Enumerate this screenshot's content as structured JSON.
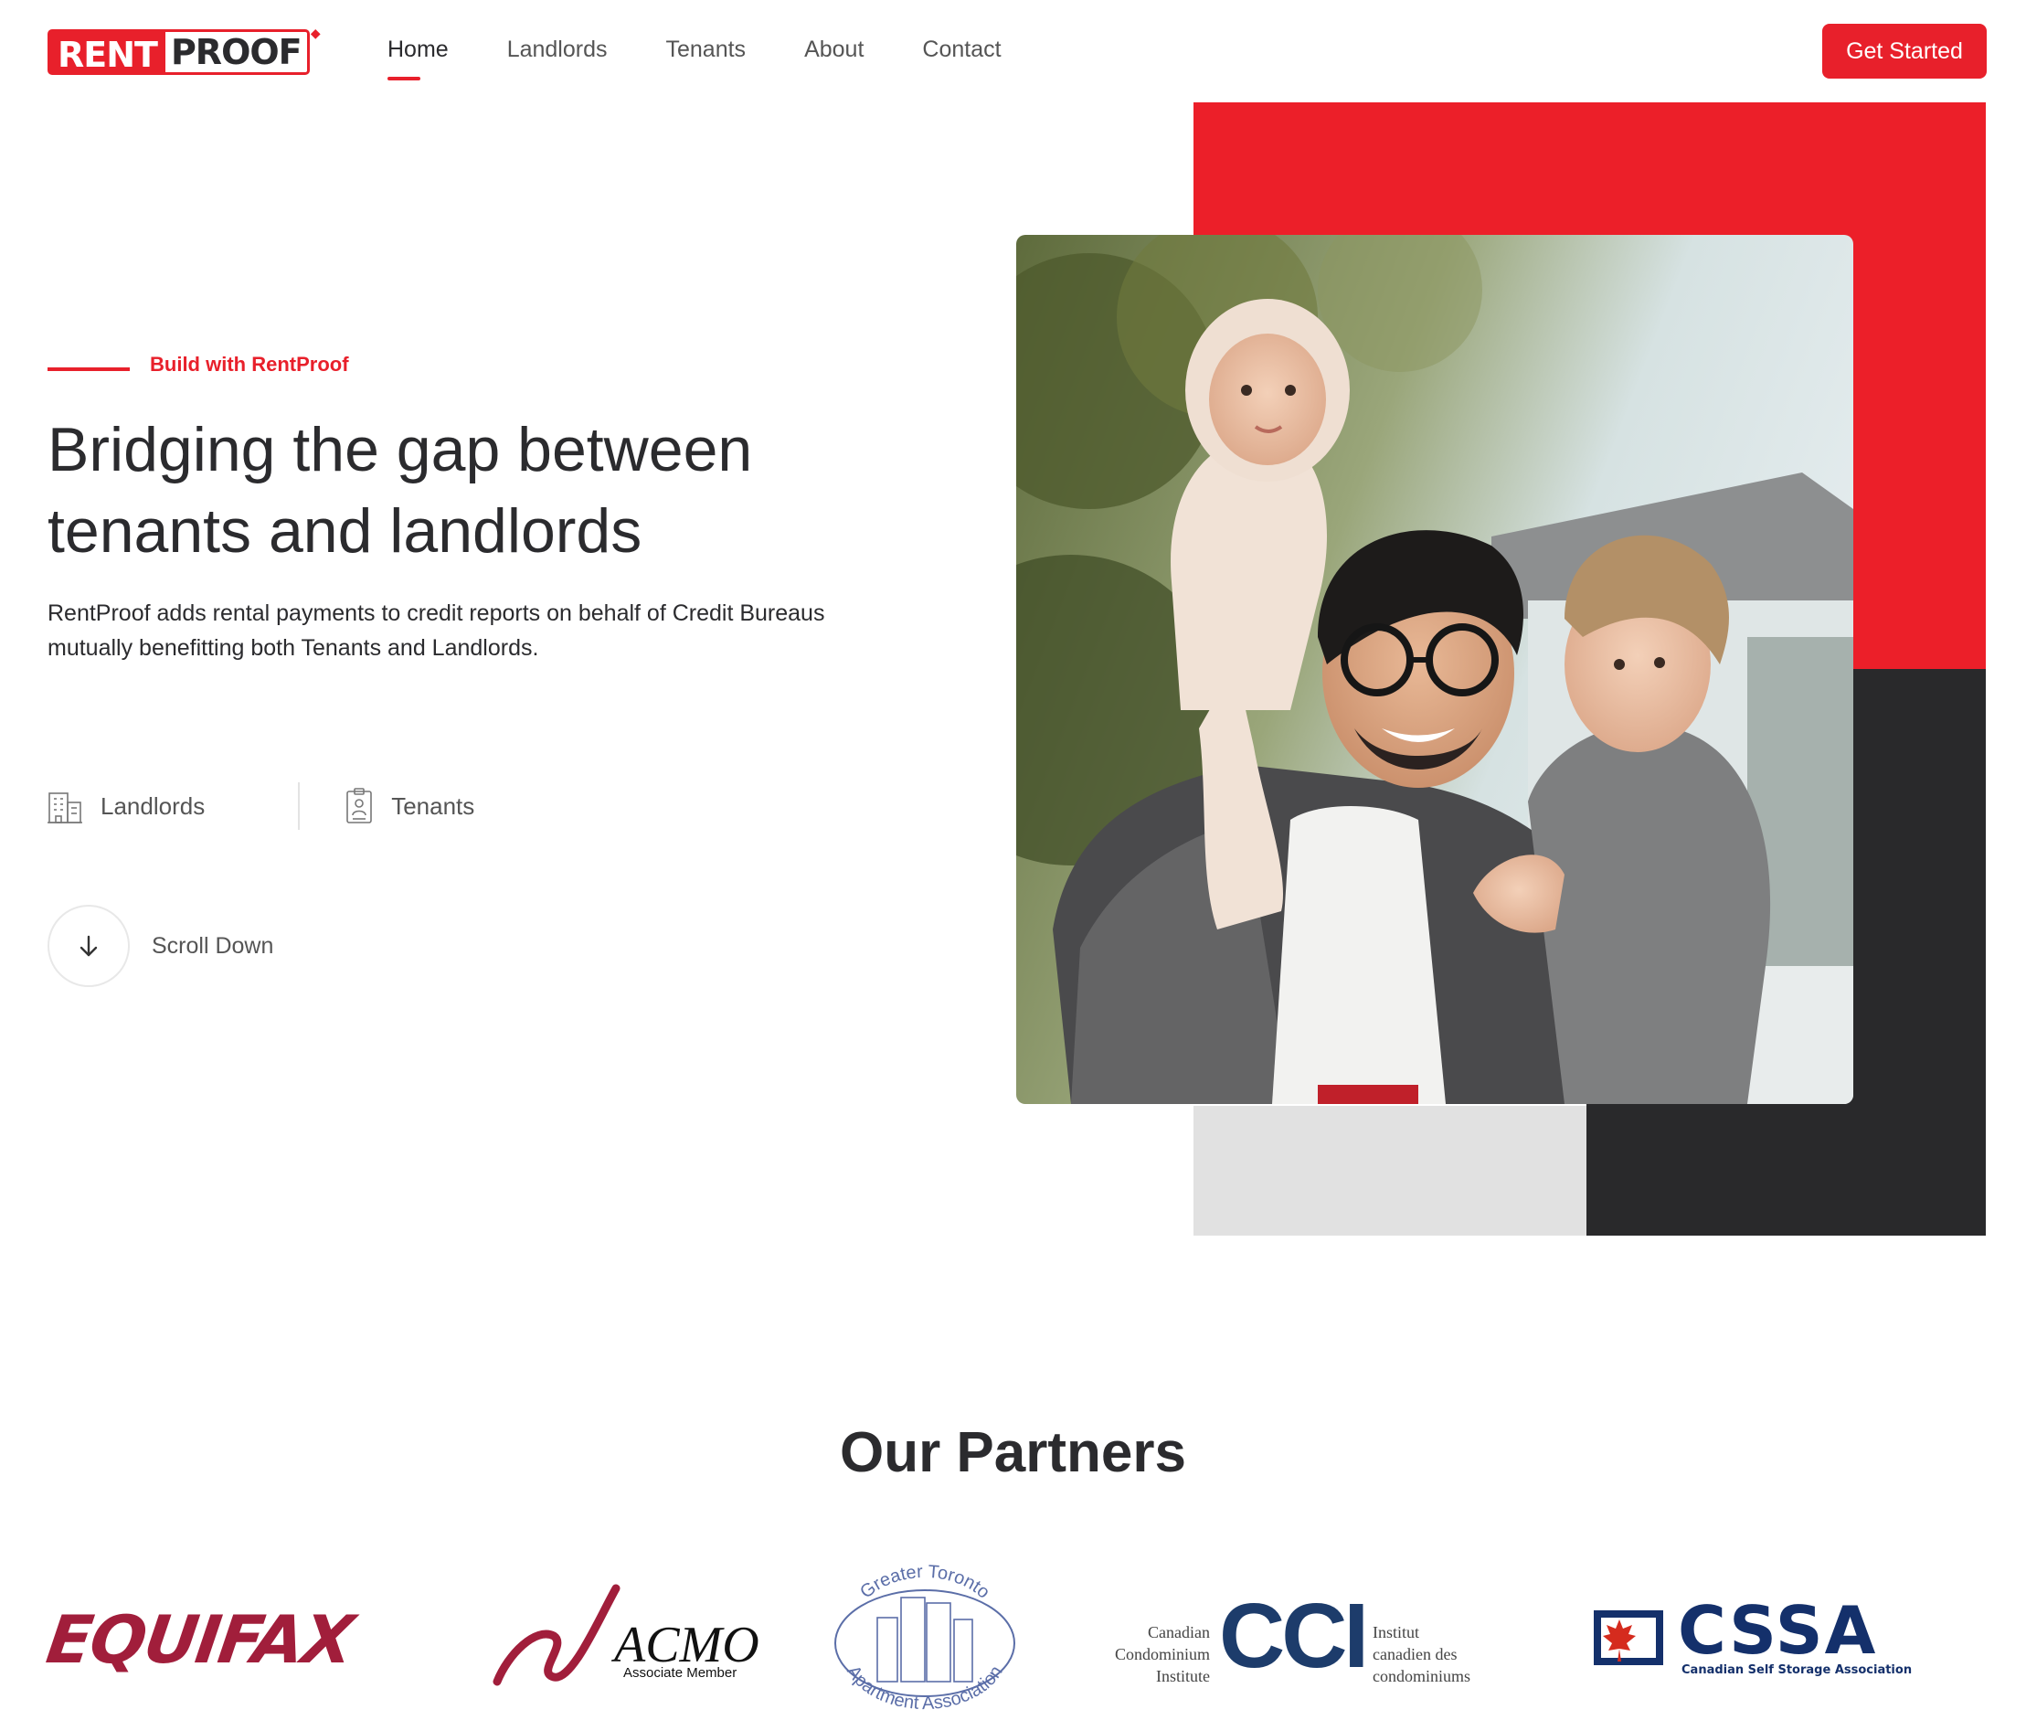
{
  "header": {
    "logo": {
      "part1": "RENT",
      "part2": "PROOF"
    },
    "nav": [
      {
        "label": "Home",
        "active": true
      },
      {
        "label": "Landlords",
        "active": false
      },
      {
        "label": "Tenants",
        "active": false
      },
      {
        "label": "About",
        "active": false
      },
      {
        "label": "Contact",
        "active": false
      }
    ],
    "cta_label": "Get Started"
  },
  "hero": {
    "eyebrow": "Build with RentProof",
    "headline_line1": "Bridging the gap between",
    "headline_line2": "tenants and landlords",
    "subtext_line1": "RentProof adds rental payments to credit reports on behalf of Credit Bureaus",
    "subtext_line2": "mutually benefitting both Tenants and Landlords.",
    "roles": [
      {
        "label": "Landlords",
        "icon": "building-icon"
      },
      {
        "label": "Tenants",
        "icon": "id-badge-icon"
      }
    ],
    "scroll_label": "Scroll Down",
    "photo_icon": "family-photo"
  },
  "partners": {
    "title": "Our Partners",
    "logos": {
      "equifax": "EQUIFAX",
      "acmo": "ACMO",
      "acmo_sub": "Associate Member",
      "gtaa_top": "Greater Toronto",
      "gtaa_bottom": "Apartment Association",
      "cci_left": [
        "Canadian",
        "Condominium",
        "Institute"
      ],
      "cci": "CCI",
      "cci_right": [
        "Institut",
        "canadien des",
        "condominiums"
      ],
      "cssa": "CSSA",
      "cssa_sub": "Canadian Self Storage Association"
    }
  },
  "colors": {
    "brand_red": "#e8202b",
    "dark": "#29292b",
    "light_grey": "#e1e1e1",
    "text": "#2b2b2e"
  }
}
